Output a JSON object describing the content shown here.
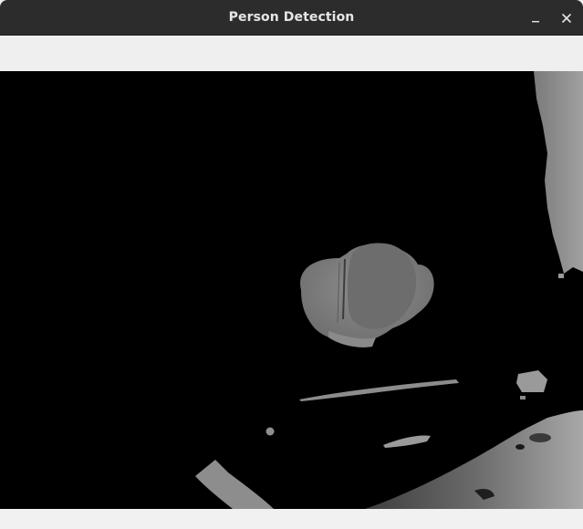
{
  "window": {
    "title": "Person Detection",
    "buttons": [
      {
        "name": "minimize",
        "icon": "minimize-icon"
      },
      {
        "name": "close",
        "icon": "close-icon"
      }
    ]
  },
  "viewport": {
    "kind": "depth-image",
    "colormap": "grayscale",
    "background": "#000000",
    "tones": {
      "near": "#8e8e8e",
      "mid": "#6f6f6f",
      "far": "#555555"
    }
  }
}
